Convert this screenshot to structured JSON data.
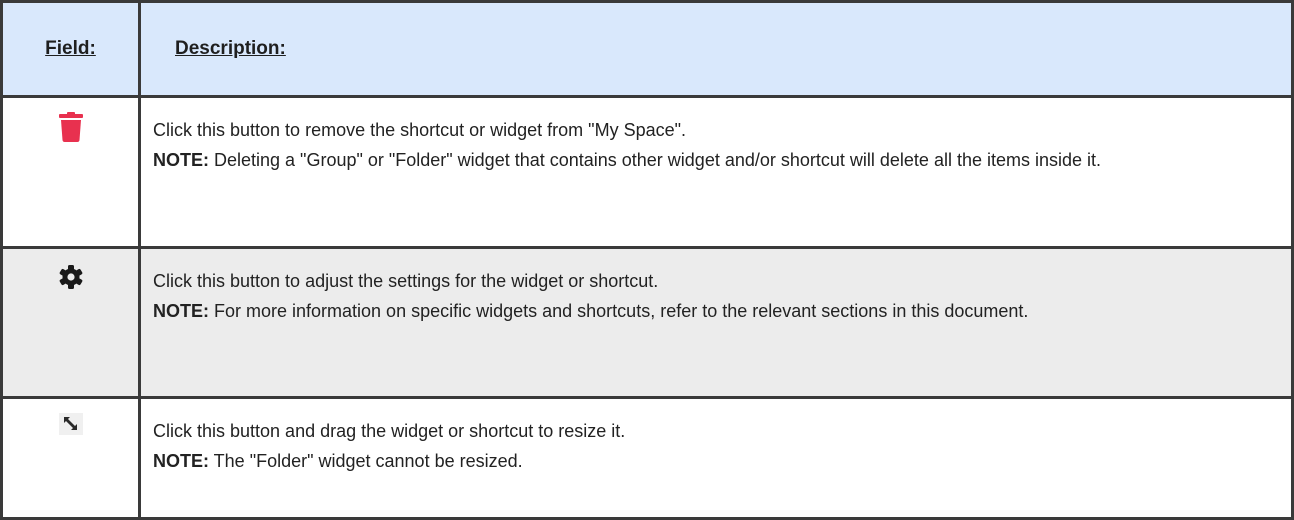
{
  "table": {
    "header": {
      "field": "Field:",
      "description": "Description:"
    },
    "rows": [
      {
        "icon": "trash-icon",
        "icon_color": "#e8314f",
        "text": "Click this button to remove the shortcut or widget from \"My Space\".",
        "note_label": "NOTE:",
        "note": " Deleting a \"Group\" or \"Folder\" widget that contains other widget and/or shortcut will delete all the items inside it."
      },
      {
        "icon": "gear-icon",
        "icon_color": "#1a1a1a",
        "text": "Click this button to adjust the settings for the widget or shortcut.",
        "note_label": "NOTE:",
        "note": " For more information on specific widgets and shortcuts, refer to the relevant sections in this document."
      },
      {
        "icon": "resize-icon",
        "icon_color": "#2a2a2a",
        "text": "Click this button and drag the widget or shortcut to resize it.",
        "note_label": "NOTE:",
        "note": " The \"Folder\" widget cannot be resized."
      }
    ]
  }
}
